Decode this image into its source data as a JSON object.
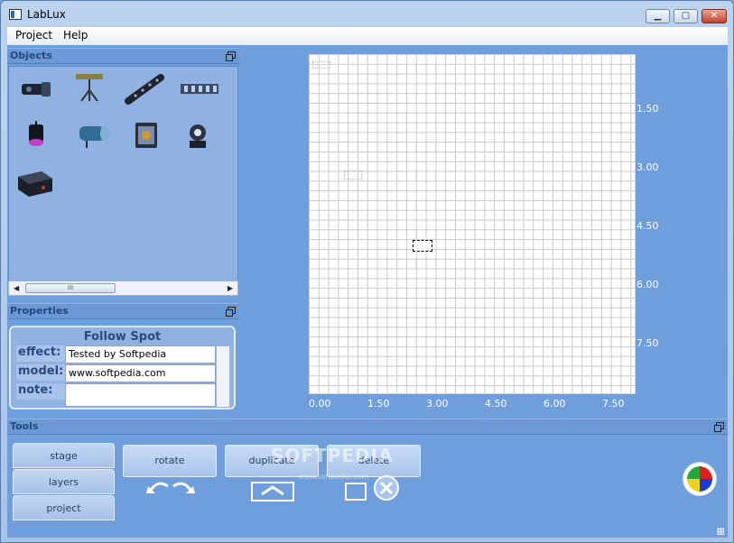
{
  "window": {
    "title": "LabLux",
    "minimize": "▁",
    "maximize": "▢",
    "close": "✕"
  },
  "menu": [
    {
      "label": "Project"
    },
    {
      "label": "Help"
    }
  ],
  "panels": {
    "objects": "Objects",
    "properties": "Properties",
    "tools": "Tools"
  },
  "objects": [
    {
      "icon": "fog-machine-icon"
    },
    {
      "icon": "tripod-light-icon"
    },
    {
      "icon": "led-bar-icon"
    },
    {
      "icon": "light-truss-icon"
    },
    {
      "icon": "par-can-icon"
    },
    {
      "icon": "follow-spot-icon"
    },
    {
      "icon": "scanner-icon"
    },
    {
      "icon": "moving-head-icon"
    },
    {
      "icon": "amplifier-icon"
    }
  ],
  "scroll_thumb_label": "III",
  "properties": {
    "title": "Follow Spot",
    "fields": [
      {
        "label": "effect:",
        "value": "Tested by Softpedia"
      },
      {
        "label": "model:",
        "value": "www.softpedia.com"
      },
      {
        "label": "note:",
        "value": ""
      }
    ]
  },
  "stage": {
    "y_ticks": [
      "1.50",
      "3.00",
      "4.50",
      "6.00",
      "7.50"
    ],
    "x_ticks": [
      "0.00",
      "1.50",
      "3.00",
      "4.50",
      "6.00",
      "7.50"
    ]
  },
  "tools": {
    "tabs": [
      {
        "label": "stage"
      },
      {
        "label": "layers"
      },
      {
        "label": "project"
      }
    ],
    "buttons": [
      {
        "label": "rotate"
      },
      {
        "label": "duplicate"
      },
      {
        "label": "delete"
      }
    ]
  },
  "watermark": {
    "text": "SOFTPEDIA",
    "sub": "www.softpedia.com"
  },
  "colors": {
    "accent": "#6e9edc",
    "panel_header": "#6a99d6",
    "title_text": "#2a4a7d"
  }
}
